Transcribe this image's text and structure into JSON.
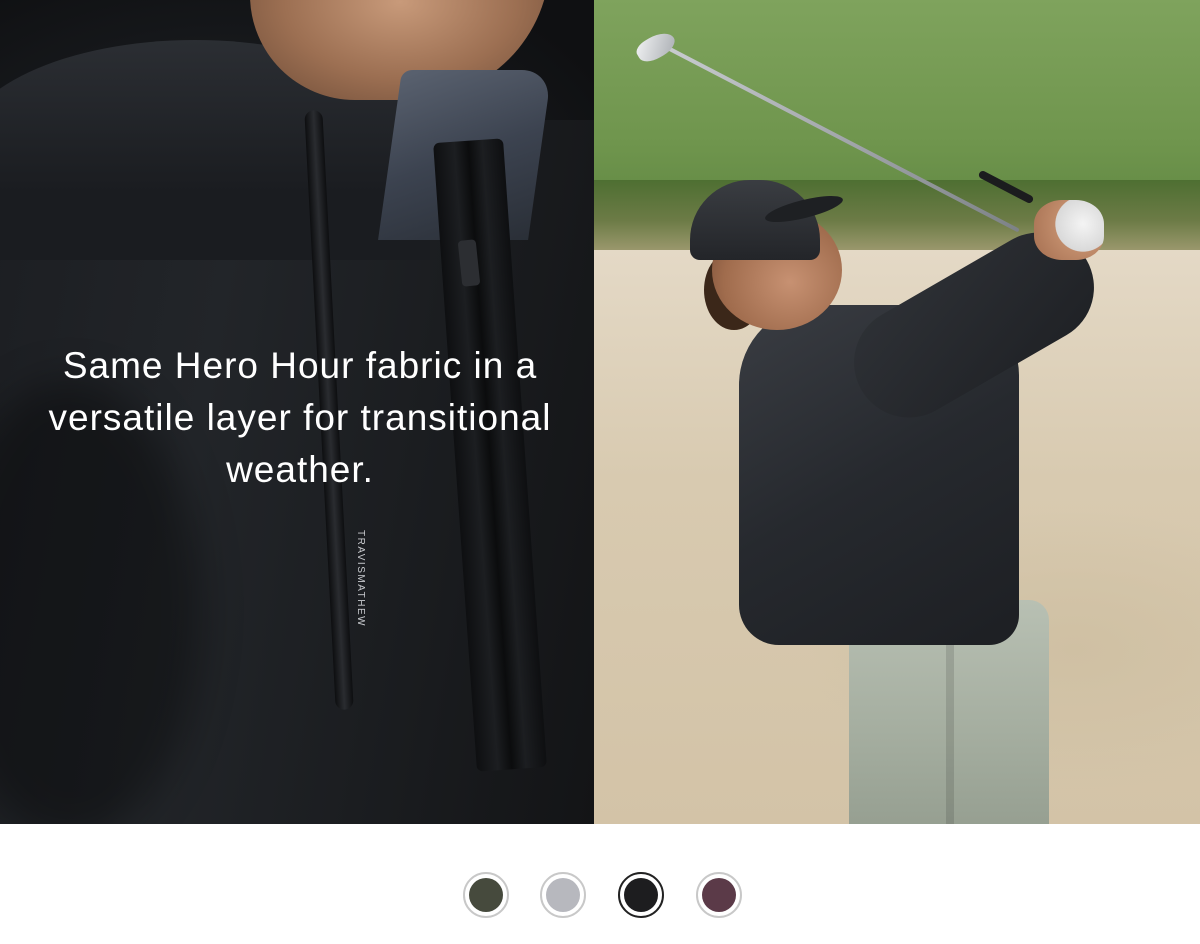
{
  "hero": {
    "headline": "Same Hero Hour fabric in a versatile layer for transitional weather.",
    "drawstring_brand": "TRAVISMATHEW"
  },
  "swatches": [
    {
      "name": "olive",
      "color": "#464a3d",
      "selected": false
    },
    {
      "name": "light-grey",
      "color": "#b7b8be",
      "selected": false
    },
    {
      "name": "black",
      "color": "#1d1d1f",
      "selected": true
    },
    {
      "name": "plum",
      "color": "#5b3a48",
      "selected": false
    }
  ]
}
